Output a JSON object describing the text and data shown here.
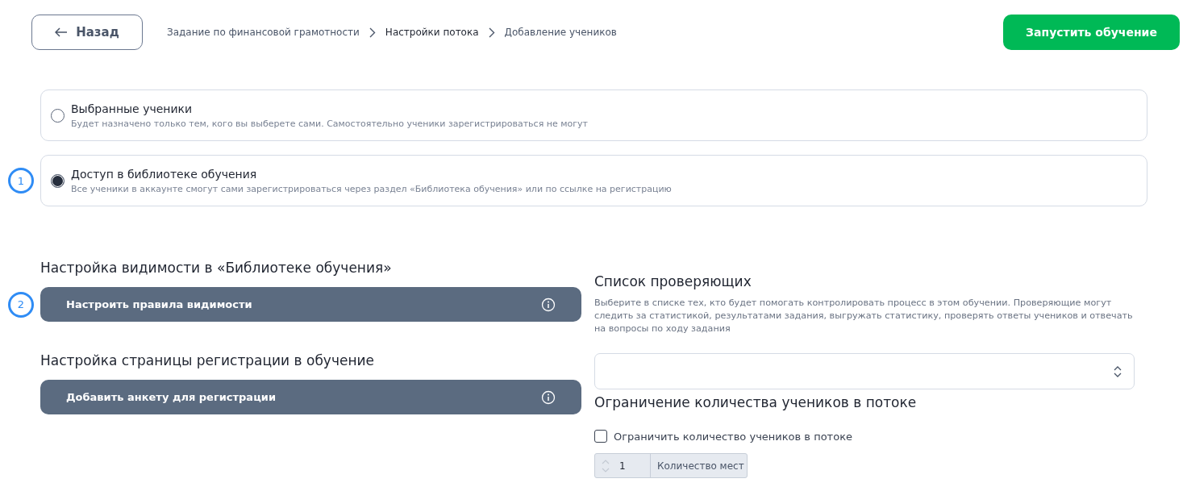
{
  "header": {
    "back_button": "Назад",
    "breadcrumbs": [
      {
        "label": "Задание по финансовой грамотности",
        "current": false
      },
      {
        "label": "Настройки потока",
        "current": true
      },
      {
        "label": "Добавление учеников",
        "current": false
      }
    ],
    "start_button": "Запустить обучение"
  },
  "access_options": [
    {
      "title": "Выбранные ученики",
      "description": "Будет назначено только тем, кого вы выберете сами. Самостоятельно ученики зарегистрироваться не могут",
      "selected": false
    },
    {
      "title": "Доступ в библиотеке обучения",
      "description": "Все ученики в аккаунте смогут сами зарегистрироваться через раздел «Библиотека обучения» или по ссылке на регистрацию",
      "selected": true,
      "step": "1"
    }
  ],
  "visibility": {
    "heading": "Настройка видимости в «Библиотеке обучения»",
    "button": "Настроить правила видимости",
    "step": "2"
  },
  "registration": {
    "heading": "Настройка страницы регистрации в обучение",
    "button": "Добавить анкету для регистрации"
  },
  "reviewers": {
    "heading": "Список проверяющих",
    "description": "Выберите в списке тех, кто будет помогать контролировать процесс в этом обучении. Проверяющие могут следить за статистикой, результатами задания, выгружать статистику, проверять ответы учеников и отвечать на вопросы по ходу задания"
  },
  "limit": {
    "heading": "Ограничение количества учеников в потоке",
    "checkbox_label": "Ограничить количество учеников в потоке",
    "checked": false,
    "seats_value": "1",
    "seats_label": "Количество мест"
  }
}
